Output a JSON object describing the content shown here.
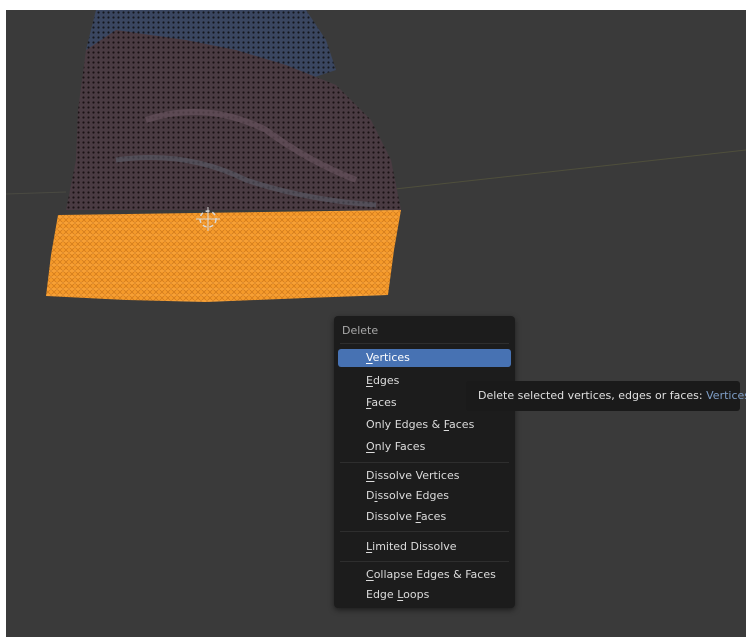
{
  "viewport": {
    "background": "#3a3a3a",
    "selection_color": "#ff9a1f"
  },
  "menu": {
    "title": "Delete",
    "items": [
      {
        "pre": "",
        "ul": "V",
        "post": "ertices"
      },
      {
        "pre": "",
        "ul": "E",
        "post": "dges"
      },
      {
        "pre": "",
        "ul": "F",
        "post": "aces"
      },
      {
        "pre": "Only Edges & ",
        "ul": "F",
        "post": "aces"
      },
      {
        "pre": "",
        "ul": "O",
        "post": "nly Faces"
      },
      {
        "pre": "",
        "ul": "D",
        "post": "issolve Vertices"
      },
      {
        "pre": "D",
        "ul": "i",
        "post": "ssolve Edges"
      },
      {
        "pre": "Dissolve ",
        "ul": "F",
        "post": "aces"
      },
      {
        "pre": "",
        "ul": "L",
        "post": "imited Dissolve"
      },
      {
        "pre": "",
        "ul": "C",
        "post": "ollapse Edges & Faces"
      },
      {
        "pre": "Edge ",
        "ul": "L",
        "post": "oops"
      }
    ]
  },
  "tooltip": {
    "text": "Delete selected vertices, edges or faces: ",
    "value": "Vertices"
  }
}
